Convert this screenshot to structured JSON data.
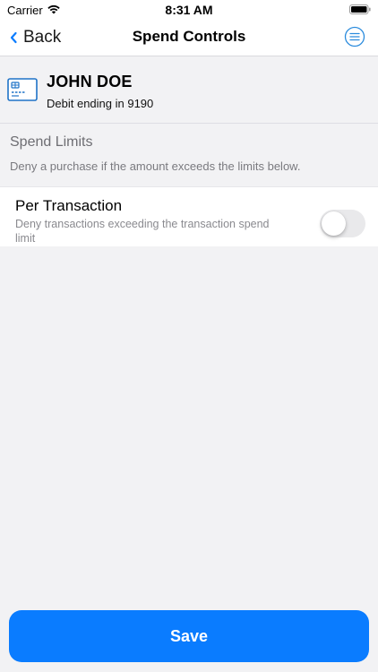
{
  "status_bar": {
    "carrier": "Carrier",
    "time": "8:31 AM",
    "icons": [
      "wifi-icon",
      "battery-icon"
    ]
  },
  "nav": {
    "back_label": "Back",
    "title": "Spend Controls",
    "icons": [
      "chevron-left-icon",
      "menu-icon"
    ]
  },
  "card": {
    "holder_name": "JOHN DOE",
    "subtitle": "Debit ending in 9190",
    "icon": "credit-card-icon"
  },
  "spend_limits": {
    "title": "Spend Limits",
    "description": "Deny a purchase if the amount exceeds the limits below.",
    "items": [
      {
        "title": "Per Transaction",
        "description": "Deny transactions exceeding the transaction spend limit",
        "enabled": false
      }
    ]
  },
  "actions": {
    "save_label": "Save"
  },
  "colors": {
    "accent": "#0a7cff",
    "background": "#f2f2f4",
    "toggle_off": "#e9e9eb"
  }
}
